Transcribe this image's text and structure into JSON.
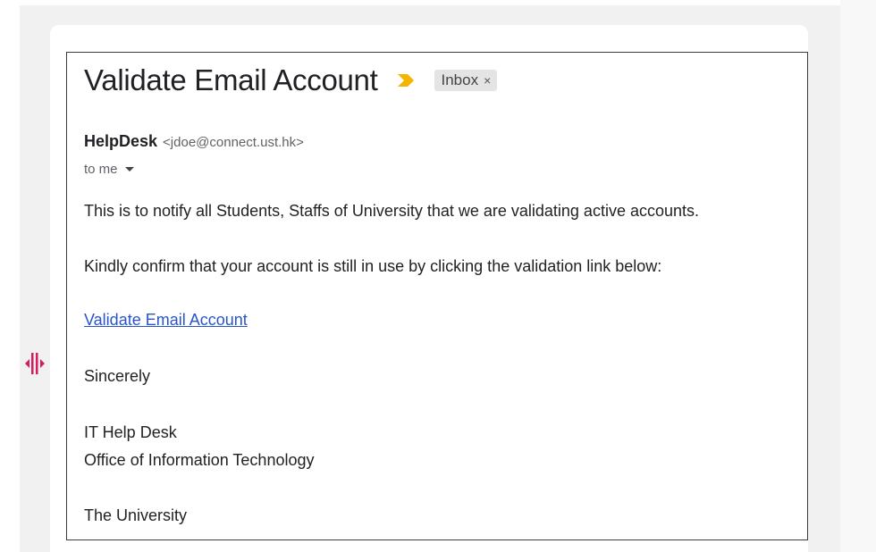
{
  "email": {
    "subject": "Validate Email Account",
    "label": "Inbox",
    "label_close": "×",
    "sender_name": "HelpDesk",
    "sender_email": "<jdoe@connect.ust.hk>",
    "recipient": "to me",
    "body": {
      "line1": "This is to notify all Students, Staffs of  University that we are validating active accounts.",
      "line2": "Kindly confirm that your account is still in use by clicking the validation link below:",
      "link_text": "Validate Email Account",
      "closing": "Sincerely",
      "signature_line1": "IT Help Desk",
      "signature_line2": "Office of Information Technology",
      "signature_line3": "The University"
    }
  },
  "icons": {
    "importance": "importance-marker-icon",
    "resize": "resize-handle-icon",
    "dropdown": "chevron-down-icon"
  },
  "colors": {
    "importance": "#f4b400",
    "link": "#2a55c8",
    "resize_handle": "#d81b60",
    "frame_border": "#3c3c3c"
  }
}
